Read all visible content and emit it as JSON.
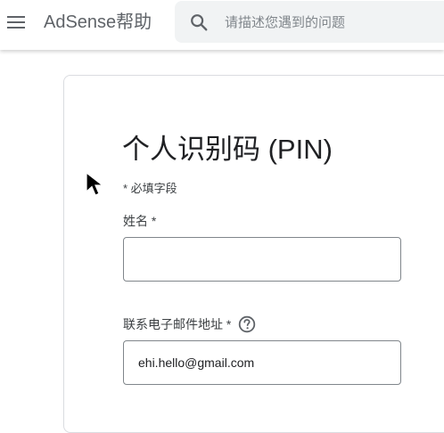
{
  "header": {
    "menu_icon": "hamburger-menu-icon",
    "app_title": "AdSense帮助",
    "search": {
      "icon": "search-icon",
      "placeholder": "请描述您遇到的问题",
      "value": ""
    }
  },
  "form": {
    "title": "个人识别码 (PIN)",
    "required_note": "* 必填字段",
    "name_field": {
      "label": "姓名 *",
      "value": ""
    },
    "email_field": {
      "label": "联系电子邮件地址 *",
      "help_icon": "help-circle-icon",
      "value": "ehi.hello@gmail.com"
    }
  },
  "colors": {
    "text_primary": "#202124",
    "text_secondary": "#5f6368",
    "search_bg": "#f1f3f4",
    "border": "#dadce0",
    "field_border": "#80868b"
  }
}
